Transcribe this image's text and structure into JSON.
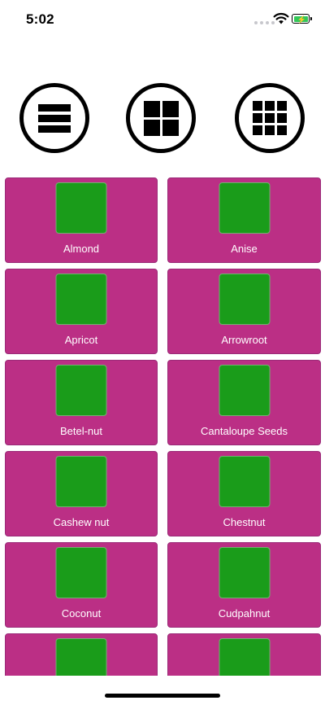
{
  "status_bar": {
    "time": "5:02"
  },
  "view_modes": [
    {
      "name": "list",
      "icon": "list-view-icon"
    },
    {
      "name": "grid2",
      "icon": "grid-2x2-icon"
    },
    {
      "name": "grid3",
      "icon": "grid-3x3-icon"
    }
  ],
  "colors": {
    "card_background": "#bb2f85",
    "thumbnail": "#1a9c1a",
    "battery": "#33c759"
  },
  "items": [
    {
      "label": "Almond"
    },
    {
      "label": "Anise"
    },
    {
      "label": "Apricot"
    },
    {
      "label": "Arrowroot"
    },
    {
      "label": "Betel-nut"
    },
    {
      "label": "Cantaloupe Seeds"
    },
    {
      "label": "Cashew nut"
    },
    {
      "label": "Chestnut"
    },
    {
      "label": "Coconut"
    },
    {
      "label": "Cudpahnut"
    },
    {
      "label": ""
    },
    {
      "label": ""
    }
  ]
}
